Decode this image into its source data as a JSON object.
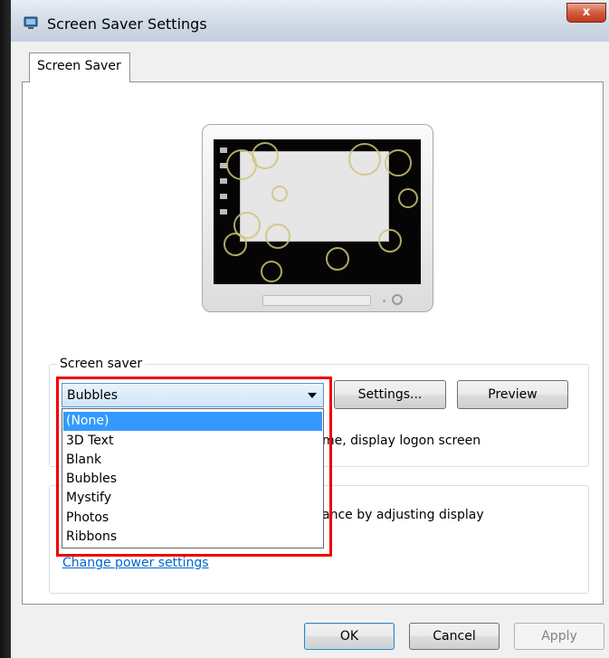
{
  "window": {
    "title": "Screen Saver Settings",
    "close_glyph": "x"
  },
  "tabs": [
    {
      "label": "Screen Saver",
      "active": true
    }
  ],
  "screen_saver_group": {
    "label": "Screen saver",
    "selected": "Bubbles",
    "settings_button": "Settings...",
    "preview_button": "Preview",
    "resume_text_visible": "me, display logon screen"
  },
  "dropdown": {
    "options": [
      "(None)",
      "3D Text",
      "Blank",
      "Bubbles",
      "Mystify",
      "Photos",
      "Ribbons"
    ],
    "highlighted_index": 0
  },
  "power_group": {
    "text_visible": "ance by adjusting display",
    "link": "Change power settings"
  },
  "footer": {
    "ok": "OK",
    "cancel": "Cancel",
    "apply": "Apply"
  },
  "colors": {
    "selection": "#3399ff",
    "link": "#0066cc",
    "highlight_box": "#ee0000",
    "close_button": "#c7402a"
  },
  "icons": {
    "window_icon": "monitor-icon",
    "close": "close-icon",
    "combo_arrow": "chevron-down-icon"
  }
}
